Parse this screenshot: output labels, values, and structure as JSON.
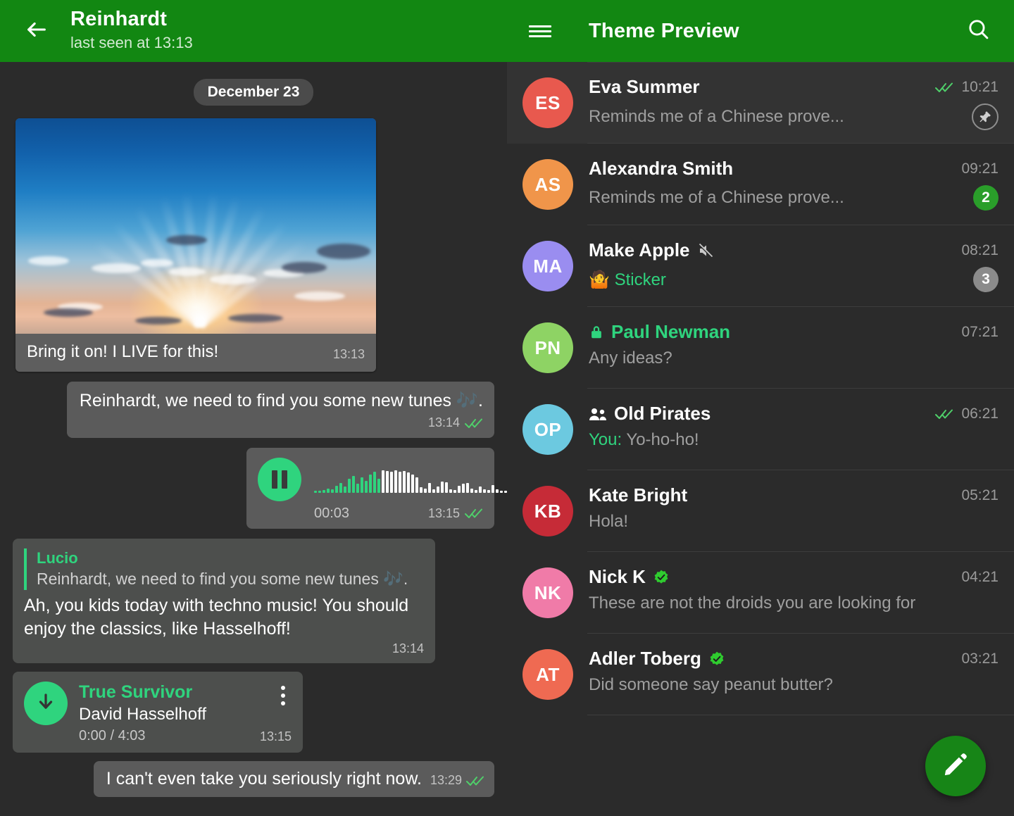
{
  "header": {
    "back_icon": "arrow-left-icon",
    "chat_title": "Reinhardt",
    "chat_subtitle": "last seen at 13:13",
    "menu_icon": "hamburger-menu-icon",
    "preview_title": "Theme Preview",
    "search_icon": "search-icon",
    "accent_green": "#128712"
  },
  "thread": {
    "date_separator": "December 23",
    "photo_message": {
      "caption": "Bring it on! I LIVE for this!",
      "time": "13:13",
      "image_alt": "sunrise-sky-photo"
    },
    "out_text_message": {
      "text": "Reinhardt, we need to find you some new tunes 🎶.",
      "time": "13:14",
      "status": "read-double-check"
    },
    "voice_message": {
      "duration": "00:03",
      "time": "13:15",
      "status": "read-double-check",
      "play_icon": "pause-icon"
    },
    "reply_message": {
      "quote_author": "Lucio",
      "quote_text": "Reinhardt, we need to find you some new tunes 🎶.",
      "body": "Ah, you kids today with techno music! You should enjoy the classics, like Hasselhoff!",
      "time": "13:14"
    },
    "music_message": {
      "title": "True Survivor",
      "artist": "David Hasselhoff",
      "position": "0:00 / 4:03",
      "time": "13:15",
      "download_icon": "download-arrow-icon",
      "menu_icon": "kebab-menu-icon"
    },
    "last_message": {
      "text": "I can't even take you seriously right now.",
      "time": "13:29",
      "status": "read-double-check"
    }
  },
  "chat_list": {
    "items": [
      {
        "initials": "ES",
        "avatar_color": "#e8594e",
        "name": "Eva Summer",
        "preview": "Reminds me of a Chinese prove...",
        "time": "10:21",
        "selected": true,
        "ticks": true,
        "pinned": true,
        "badge": null,
        "badge_muted": false,
        "muted": false,
        "secret": false,
        "verified": false,
        "group": false,
        "you_prefix": null,
        "sticker": false
      },
      {
        "initials": "AS",
        "avatar_color": "#f0954a",
        "name": "Alexandra Smith",
        "preview": "Reminds me of a Chinese prove...",
        "time": "09:21",
        "selected": false,
        "ticks": false,
        "pinned": false,
        "badge": "2",
        "badge_muted": false,
        "muted": false,
        "secret": false,
        "verified": false,
        "group": false,
        "you_prefix": null,
        "sticker": false
      },
      {
        "initials": "MA",
        "avatar_color": "#9a8df0",
        "name": "Make Apple",
        "preview": "🤷 Sticker",
        "time": "08:21",
        "selected": false,
        "ticks": false,
        "pinned": false,
        "badge": "3",
        "badge_muted": true,
        "muted": true,
        "secret": false,
        "verified": false,
        "group": false,
        "you_prefix": null,
        "sticker": true
      },
      {
        "initials": "PN",
        "avatar_color": "#8ed364",
        "name": "Paul Newman",
        "preview": "Any ideas?",
        "time": "07:21",
        "selected": false,
        "ticks": false,
        "pinned": false,
        "badge": null,
        "badge_muted": false,
        "muted": false,
        "secret": true,
        "verified": false,
        "group": false,
        "you_prefix": null,
        "sticker": false
      },
      {
        "initials": "OP",
        "avatar_color": "#6cc9e0",
        "name": "Old Pirates",
        "preview": "Yo-ho-ho!",
        "time": "06:21",
        "selected": false,
        "ticks": true,
        "pinned": false,
        "badge": null,
        "badge_muted": false,
        "muted": false,
        "secret": false,
        "verified": false,
        "group": true,
        "you_prefix": "You:",
        "sticker": false
      },
      {
        "initials": "KB",
        "avatar_color": "#c62b37",
        "name": "Kate Bright",
        "preview": "Hola!",
        "time": "05:21",
        "selected": false,
        "ticks": false,
        "pinned": false,
        "badge": null,
        "badge_muted": false,
        "muted": false,
        "secret": false,
        "verified": false,
        "group": false,
        "you_prefix": null,
        "sticker": false
      },
      {
        "initials": "NK",
        "avatar_color": "#f07ba8",
        "name": "Nick K",
        "preview": "These are not the droids you are looking for",
        "time": "04:21",
        "selected": false,
        "ticks": false,
        "pinned": false,
        "badge": null,
        "badge_muted": false,
        "muted": false,
        "secret": false,
        "verified": true,
        "group": false,
        "you_prefix": null,
        "sticker": false
      },
      {
        "initials": "AT",
        "avatar_color": "#ef6a52",
        "name": "Adler Toberg",
        "preview": "Did someone say peanut butter?",
        "time": "03:21",
        "selected": false,
        "ticks": false,
        "pinned": false,
        "badge": null,
        "badge_muted": false,
        "muted": false,
        "secret": false,
        "verified": true,
        "group": false,
        "you_prefix": null,
        "sticker": false
      }
    ],
    "loading_spinner": "loading-arc",
    "fab_icon": "compose-pencil-icon"
  },
  "colors": {
    "header_green": "#128712",
    "accent_green": "#2fd47e",
    "badge_green": "#2a9e2a",
    "panel_bg": "#2b2b2b",
    "selected_row": "#333333",
    "bubble_out": "#5b5b5b",
    "bubble_in": "#4d4f4d"
  }
}
